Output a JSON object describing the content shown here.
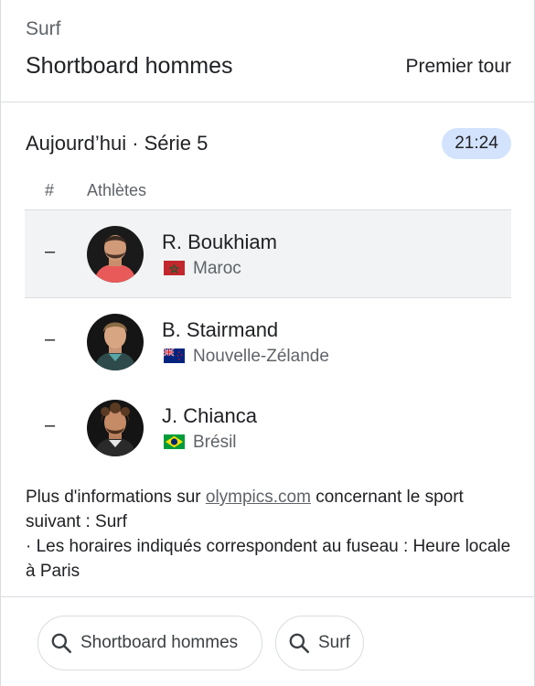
{
  "header": {
    "sport": "Surf",
    "event": "Shortboard hommes",
    "round": "Premier tour"
  },
  "series": {
    "title": "Aujourd’hui · Série 5",
    "time": "21:24"
  },
  "table": {
    "col_rank": "#",
    "col_athletes": "Athlètes",
    "rows": [
      {
        "rank": "–",
        "name": "R. Boukhiam",
        "country": "Maroc",
        "flag_icon": "morocco-flag-icon",
        "highlighted": true
      },
      {
        "rank": "–",
        "name": "B. Stairmand",
        "country": "Nouvelle-Zélande",
        "flag_icon": "new-zealand-flag-icon",
        "highlighted": false
      },
      {
        "rank": "–",
        "name": "J. Chianca",
        "country": "Brésil",
        "flag_icon": "brazil-flag-icon",
        "highlighted": false
      }
    ]
  },
  "info": {
    "prefix": "Plus d'informations sur ",
    "link": "olympics.com",
    "suffix": " concernant le sport suivant : Surf",
    "note": "· Les horaires indiqués correspondent au fuseau : Heure locale à Paris"
  },
  "chips": [
    {
      "label": "Shortboard hommes",
      "icon": "search-icon"
    },
    {
      "label": "Surf",
      "icon": "search-icon"
    }
  ],
  "colors": {
    "badge_bg": "#d3e3fd",
    "row_highlight": "#f1f3f4",
    "divider": "#dadce0",
    "secondary_text": "#5f6368"
  }
}
